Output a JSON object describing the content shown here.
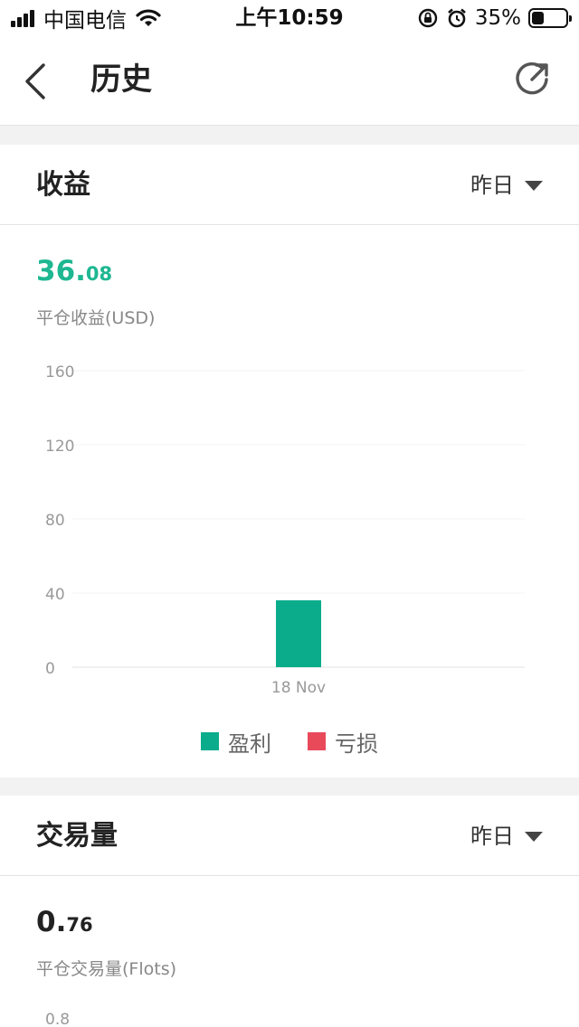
{
  "status_bar": {
    "carrier": "中国电信",
    "time": "上午10:59",
    "battery": "35%",
    "battery_level": 0.35,
    "icons": [
      "signal-icon",
      "wifi-icon",
      "rotation-lock-icon",
      "alarm-icon",
      "battery-icon"
    ]
  },
  "nav": {
    "title": "历史",
    "icons": [
      "back-icon",
      "refresh-icon"
    ]
  },
  "profit_section": {
    "title": "收益",
    "period": "昨日",
    "value_int": "36.",
    "value_dec": "08",
    "value_label": "平仓收益(USD)",
    "accent_color": "#1db791"
  },
  "volume_section": {
    "title": "交易量",
    "period": "昨日",
    "value_int": "0.",
    "value_dec": "76",
    "value_label": "平仓交易量(Flots)",
    "partial_tick": "0.8"
  },
  "chart_data": {
    "type": "bar",
    "categories": [
      "18 Nov"
    ],
    "series": [
      {
        "name": "盈利",
        "values": [
          36.08
        ],
        "color": "#0aac8b"
      },
      {
        "name": "亏损",
        "values": [
          0
        ],
        "color": "#e84a5a"
      }
    ],
    "yticks": [
      0,
      40,
      80,
      120,
      160
    ],
    "ylim": [
      0,
      160
    ],
    "grid": true,
    "legend_position": "bottom"
  }
}
